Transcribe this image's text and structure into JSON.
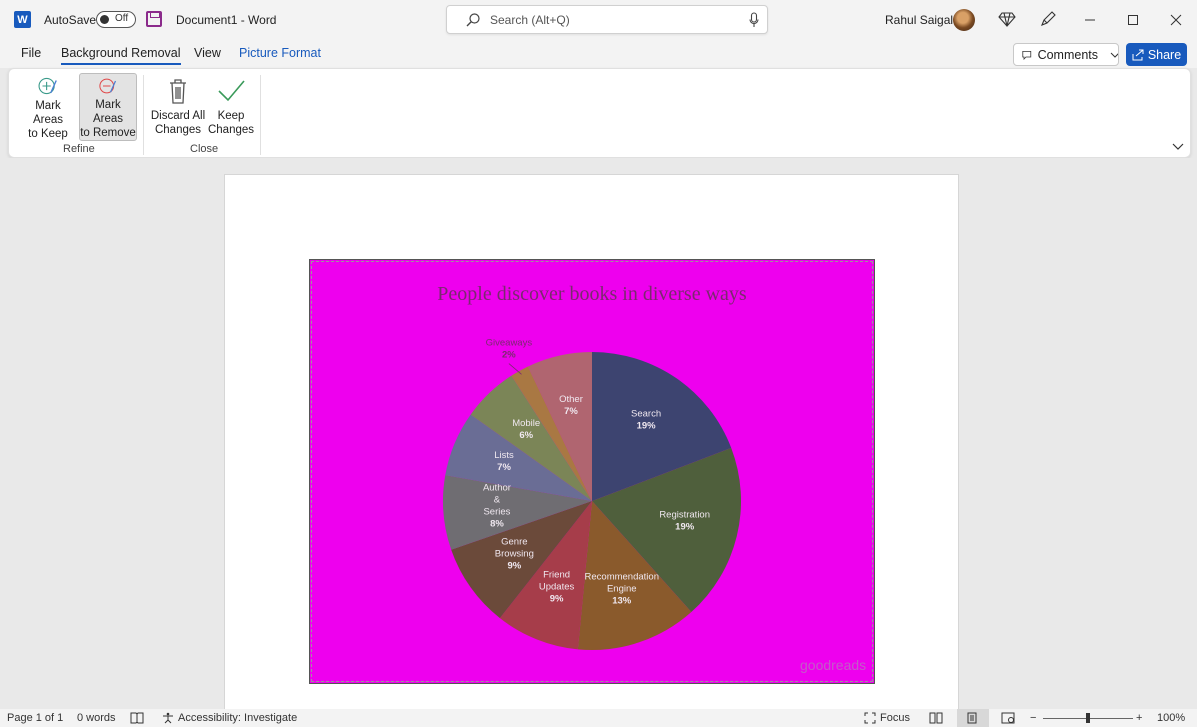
{
  "titlebar": {
    "app_logo_letter": "W",
    "autosave_label": "AutoSave",
    "autosave_state": "Off",
    "doc_title": "Document1  -  Word",
    "search_placeholder": "Search (Alt+Q)",
    "user_name": "Rahul Saigal"
  },
  "menubar": {
    "tabs": [
      {
        "label": "File"
      },
      {
        "label": "Background Removal"
      },
      {
        "label": "View"
      },
      {
        "label": "Picture Format"
      }
    ],
    "comments_label": "Comments",
    "share_label": "Share"
  },
  "ribbon": {
    "groups": [
      {
        "label": "Refine",
        "buttons": [
          {
            "line1": "Mark Areas",
            "line2": "to Keep"
          },
          {
            "line1": "Mark Areas",
            "line2": "to Remove"
          }
        ]
      },
      {
        "label": "Close",
        "buttons": [
          {
            "line1": "Discard All",
            "line2": "Changes"
          },
          {
            "line1": "Keep",
            "line2": "Changes"
          }
        ]
      }
    ]
  },
  "picture": {
    "background_color": "#ee00ee",
    "watermark": "goodreads"
  },
  "chart_data": {
    "type": "pie",
    "title": "People discover books in diverse ways",
    "slices": [
      {
        "label": "Search",
        "value": 19,
        "pct": "19%",
        "color": "#3d4470"
      },
      {
        "label": "Registration",
        "value": 19,
        "pct": "19%",
        "color": "#4f5f3c"
      },
      {
        "label": "Recommendation Engine",
        "value": 13,
        "pct": "13%",
        "color": "#8a5a2c"
      },
      {
        "label": "Friend Updates",
        "value": 9,
        "pct": "9%",
        "color": "#a63d4a"
      },
      {
        "label": "Genre Browsing",
        "value": 9,
        "pct": "9%",
        "color": "#6b4a3a"
      },
      {
        "label": "Author & Series",
        "value": 8,
        "pct": "8%",
        "color": "#6f6d72"
      },
      {
        "label": "Lists",
        "value": 7,
        "pct": "7%",
        "color": "#6a6d95"
      },
      {
        "label": "Mobile",
        "value": 6,
        "pct": "6%",
        "color": "#7b8557"
      },
      {
        "label": "Giveaways",
        "value": 2,
        "pct": "2%",
        "color": "#a97843"
      },
      {
        "label": "Other",
        "value": 7,
        "pct": "7%",
        "color": "#b06570"
      }
    ]
  },
  "statusbar": {
    "page": "Page 1 of 1",
    "words": "0 words",
    "accessibility": "Accessibility: Investigate",
    "focus": "Focus",
    "zoom_minus": "−",
    "zoom_plus": "+",
    "zoom": "100%"
  }
}
